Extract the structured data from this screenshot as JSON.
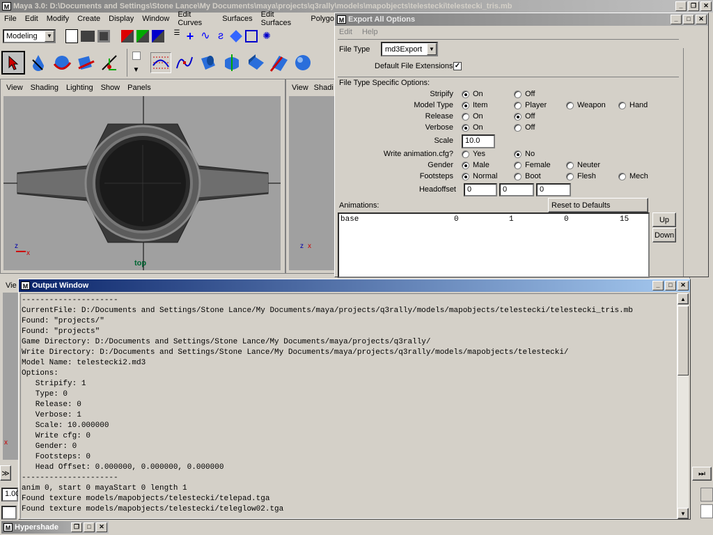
{
  "maya": {
    "title": "Maya 3.0: D:\\Documents and Settings\\Stone Lance\\My Documents\\maya\\projects\\q3rally\\models\\mapobjects\\telestecki\\telestecki_tris.mb",
    "menu": [
      "File",
      "Edit",
      "Modify",
      "Create",
      "Display",
      "Window",
      "Edit Curves",
      "Surfaces",
      "Edit Surfaces",
      "Polygo"
    ],
    "mode": "Modeling",
    "viewport_menu": [
      "View",
      "Shading",
      "Lighting",
      "Show",
      "Panels"
    ],
    "viewport2_menu": [
      "View",
      "Shadi"
    ],
    "viewport3_menu": [
      "Vie"
    ],
    "top_label": "top",
    "axis_x": "x",
    "axis_z": "z",
    "hypershade": "Hypershade",
    "bottom_field": "1.00"
  },
  "export": {
    "title": "Export All Options",
    "menu": [
      "Edit",
      "Help"
    ],
    "file_type_label": "File Type",
    "file_type_value": "md3Export",
    "default_ext_label": "Default File Extensions",
    "default_ext_checked": true,
    "specific_label": "File Type Specific Options:",
    "options": [
      {
        "label": "Stripify",
        "choices": [
          "On",
          "Off"
        ],
        "selected": 0
      },
      {
        "label": "Model Type",
        "choices": [
          "Item",
          "Player",
          "Weapon",
          "Hand"
        ],
        "selected": 0
      },
      {
        "label": "Release",
        "choices": [
          "On",
          "Off"
        ],
        "selected": 1
      },
      {
        "label": "Verbose",
        "choices": [
          "On",
          "Off"
        ],
        "selected": 0
      }
    ],
    "scale_label": "Scale",
    "scale_value": "10.0",
    "write_anim_label": "Write animation.cfg?",
    "write_anim_choices": [
      "Yes",
      "No"
    ],
    "write_anim_selected": 1,
    "gender_label": "Gender",
    "gender_choices": [
      "Male",
      "Female",
      "Neuter"
    ],
    "gender_selected": 0,
    "footsteps_label": "Footsteps",
    "footsteps_choices": [
      "Normal",
      "Boot",
      "Flesh",
      "Mech"
    ],
    "footsteps_selected": 0,
    "headoffset_label": "Headoffset",
    "headoffset_values": [
      "0",
      "0",
      "0"
    ],
    "animations_label": "Animations:",
    "reset_label": "Reset to Defaults",
    "anim_row": {
      "name": "base",
      "c1": "0",
      "c2": "1",
      "c3": "0",
      "c4": "15"
    },
    "up_label": "Up",
    "down_label": "Down"
  },
  "output": {
    "title": "Output Window",
    "lines": [
      "---------------------",
      "CurrentFile: D:/Documents and Settings/Stone Lance/My Documents/maya/projects/q3rally/models/mapobjects/telestecki/telestecki_tris.mb",
      "Found: \"projects/\"",
      "Found: \"projects\"",
      "Game Directory: D:/Documents and Settings/Stone Lance/My Documents/maya/projects/q3rally/",
      "Write Directory: D:/Documents and Settings/Stone Lance/My Documents/maya/projects/q3rally/models/mapobjects/telestecki/",
      "Model Name: telestecki2.md3",
      "Options:",
      "   Stripify: 1",
      "   Type: 0",
      "   Release: 0",
      "   Verbose: 1",
      "   Scale: 10.000000",
      "   Write cfg: 0",
      "   Gender: 0",
      "   Footsteps: 0",
      "   Head Offset: 0.000000, 0.000000, 0.000000",
      "---------------------",
      "anim 0, start 0 mayaStart 0 length 1",
      "Found texture models/mapobjects/telestecki/telepad.tga",
      "Found texture models/mapobjects/telestecki/teleglow02.tga"
    ]
  }
}
